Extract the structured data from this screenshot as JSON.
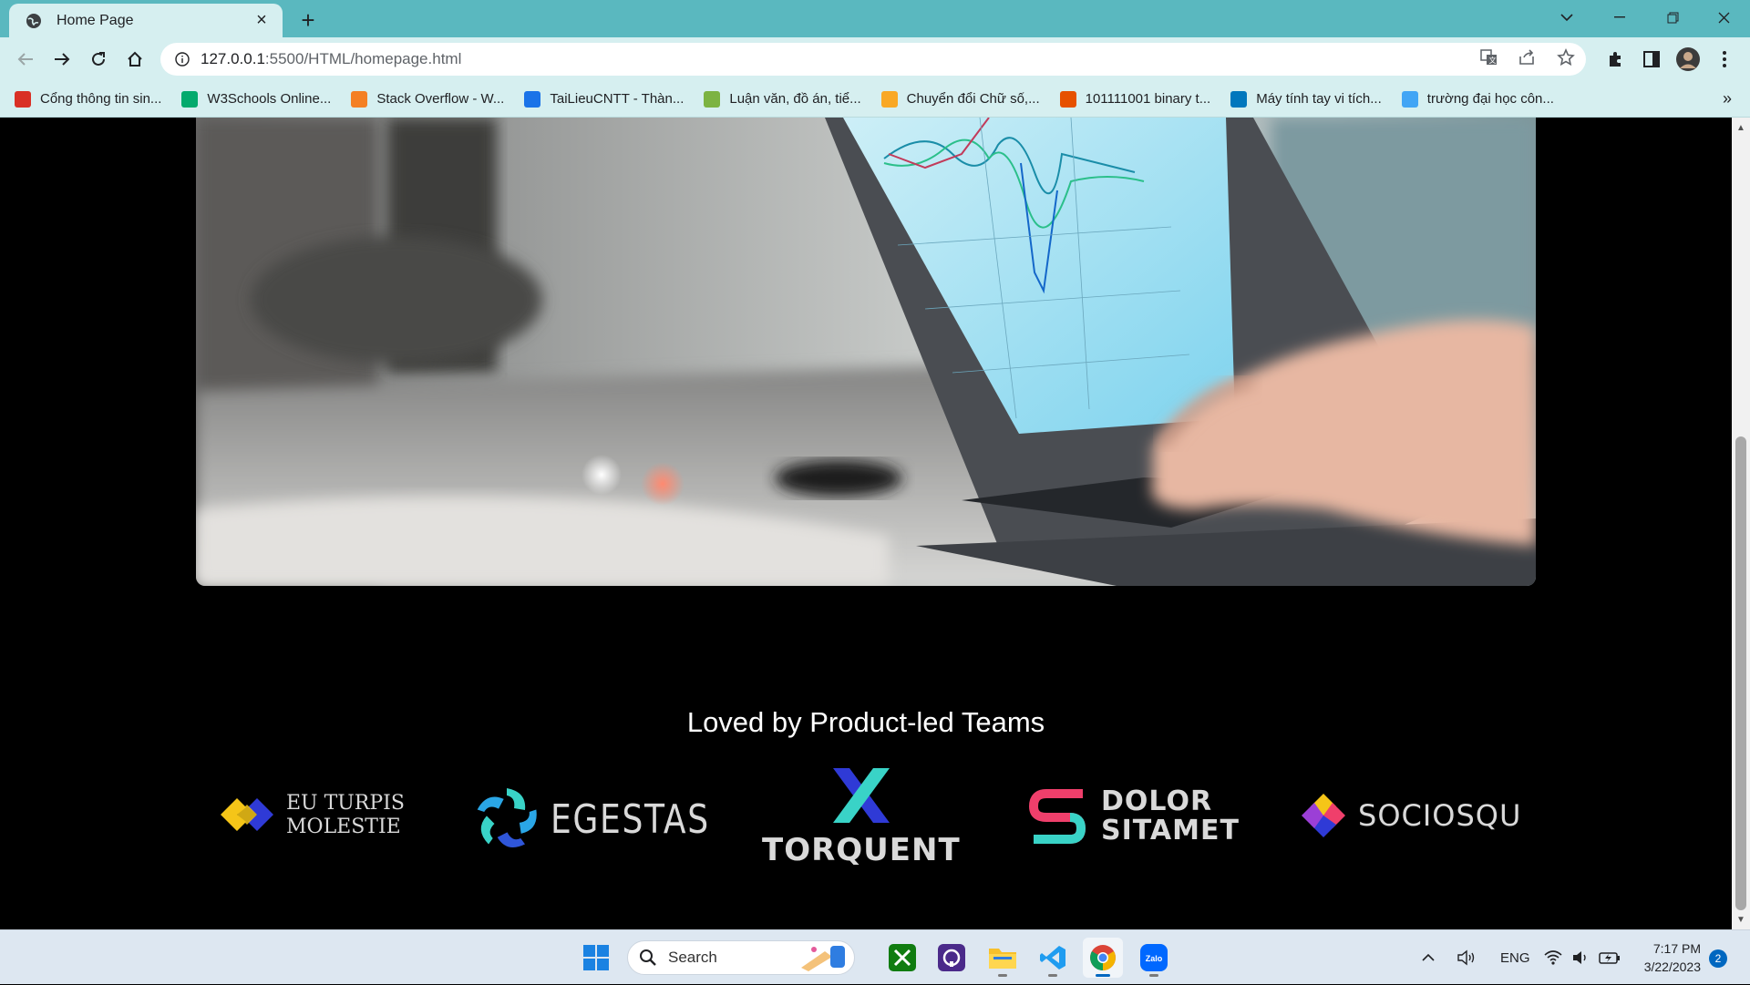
{
  "browser": {
    "tab_title": "Home Page",
    "url_host": "127.0.0.1",
    "url_rest": ":5500/HTML/homepage.html",
    "bookmarks": [
      {
        "label": "Cổng thông tin sin...",
        "color": "#d93025"
      },
      {
        "label": "W3Schools Online...",
        "color": "#04aa6d"
      },
      {
        "label": "Stack Overflow - W...",
        "color": "#f48024"
      },
      {
        "label": "TaiLieuCNTT - Thàn...",
        "color": "#1a73e8"
      },
      {
        "label": "Luận văn, đồ án, tiể...",
        "color": "#7cb342"
      },
      {
        "label": "Chuyển đổi Chữ số,...",
        "color": "#f9a825"
      },
      {
        "label": "101111001 binary t...",
        "color": "#e65100"
      },
      {
        "label": "Máy tính tay vi tích...",
        "color": "#0277bd"
      },
      {
        "label": "trường đại học côn...",
        "color": "#42a5f5"
      }
    ]
  },
  "page": {
    "section_title": "Loved by Product-led Teams",
    "logos": {
      "eu_line1": "EU TURPIS",
      "eu_line2": "MOLESTIE",
      "egestas": "EGESTAS",
      "torquent": "TORQUENT",
      "dolor_line1": "DOLOR",
      "dolor_line2": "SITAMET",
      "sociosqu": "SOCIOSQU"
    }
  },
  "taskbar": {
    "search_label": "Search",
    "language": "ENG",
    "time": "7:17 PM",
    "date": "3/22/2023",
    "notification_count": "2"
  }
}
